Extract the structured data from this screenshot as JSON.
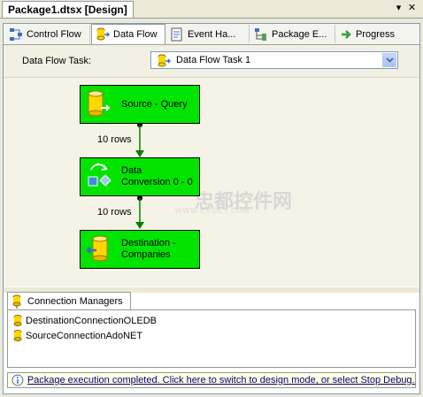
{
  "window": {
    "document_tab": "Package1.dtsx [Design]",
    "pin_glyph": "▾",
    "close_glyph": "✕"
  },
  "tabs": [
    {
      "label": "Control Flow",
      "icon": "control-flow-icon"
    },
    {
      "label": "Data Flow",
      "icon": "data-flow-icon",
      "active": true
    },
    {
      "label": "Event Ha...",
      "icon": "event-handlers-icon"
    },
    {
      "label": "Package E...",
      "icon": "package-explorer-icon"
    },
    {
      "label": "Progress",
      "icon": "progress-icon"
    }
  ],
  "task": {
    "label": "Data Flow Task:",
    "selected": "Data Flow Task 1"
  },
  "flow": {
    "source": {
      "name": "Source - Query"
    },
    "path1": {
      "rows": "10 rows"
    },
    "conversion": {
      "line1": "Data",
      "line2": "Conversion 0 - 0"
    },
    "path2": {
      "rows": "10 rows"
    },
    "destination": {
      "line1": "Destination -",
      "line2": "Companies"
    }
  },
  "watermark": {
    "text": "忠都控件网",
    "url": "WWW.EVGET.COM"
  },
  "connection_managers": {
    "tab_label": "Connection Managers",
    "items": [
      {
        "name": "DestinationConnectionOLEDB"
      },
      {
        "name": "SourceConnectionAdoNET"
      }
    ]
  },
  "status": {
    "text": "Package execution completed. Click here to switch to design mode, or select Stop Debug..."
  },
  "colors": {
    "node_fill": "#00e400",
    "canvas": "#f5f3e5",
    "arrow": "#008000",
    "link": "#000080"
  }
}
